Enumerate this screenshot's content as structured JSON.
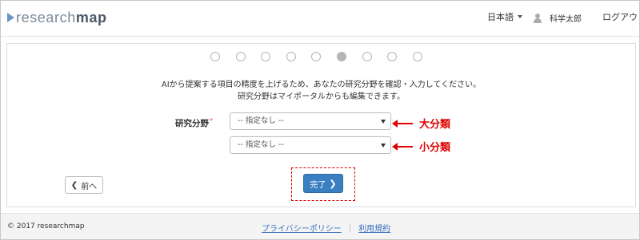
{
  "header": {
    "logo_text_light": "research",
    "logo_text_bold": "map",
    "language": "日本語",
    "user_name": "科学太郎",
    "logout": "ログアウト"
  },
  "progress": {
    "total_steps": 9,
    "current_step": 6
  },
  "intro": {
    "line1": "AIから提案する項目の精度を上げるため、あなたの研究分野を確認・入力してください。",
    "line2": "研究分野はマイポータルからも編集できます。"
  },
  "form": {
    "field_label": "研究分野",
    "required_mark": "*",
    "major_select_value": "-- 指定なし --",
    "minor_select_value": "-- 指定なし --"
  },
  "annotations": {
    "major": "大分類",
    "minor": "小分類",
    "color": "#e00000"
  },
  "buttons": {
    "prev": "前へ",
    "done": "完了"
  },
  "footer": {
    "copyright": "2017 researchmap",
    "privacy": "プライバシーポリシー",
    "terms": "利用規約"
  },
  "colors": {
    "primary_button": "#3a7fc1",
    "link": "#3a6fbf",
    "step_active": "#b5b5b5"
  },
  "icons": [
    "logo-triangle-icon",
    "caret-down-icon",
    "user-icon",
    "chevron-left-icon",
    "chevron-right-icon",
    "copyright-icon",
    "red-arrow-icon"
  ]
}
